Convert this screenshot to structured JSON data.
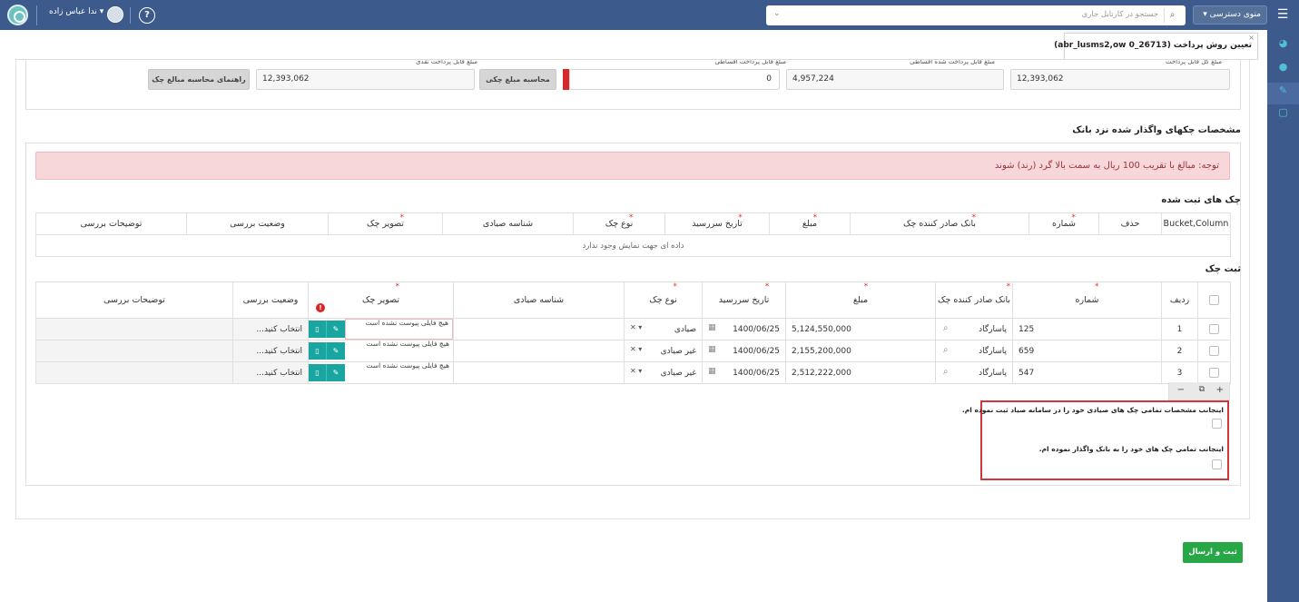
{
  "topbar": {
    "dropdown_label": "منوی دسترسی",
    "search_placeholder": "جستجو در کارتابل جاری",
    "help_label": "?",
    "user_name": "ندا عباس زاده"
  },
  "tab": {
    "title": "تعیین روش پرداخت (abr_lusms2,ow 0_26713)",
    "close": "×"
  },
  "summary": {
    "labels": [
      "مبلغ کل قابل پرداخت",
      "مبلغ قابل پرداخت شده اقساطی",
      "مبلغ قابل پرداخت اقساطی",
      "مبلغ قابل پرداخت نقدی"
    ],
    "values": [
      "12,393,062",
      "4,957,224",
      "0",
      "12,393,062"
    ],
    "calc_button": "محاسبه مبلغ چکی",
    "guide_button": "راهنمای محاسبه مبالغ چک"
  },
  "cheque_section": {
    "title": "مشخصات چکهای واگذار شده نزد بانک",
    "alert": "توجه: مبالغ با تقریب 100 ریال به سمت بالا گرد (رند) شوند"
  },
  "registered": {
    "title": "چک های ثبت شده",
    "headers": [
      "Bucket,Column",
      "حذف",
      "شماره",
      "بانک صادر کننده چک",
      "مبلغ",
      "تاریخ سررسید",
      "نوع چک",
      "شناسه صیادی",
      "تصویر چک",
      "وضعیت بررسی",
      "توضیحات بررسی"
    ],
    "empty_text": "داده ای جهت نمایش وجود ندارد"
  },
  "new_cheques": {
    "title": "ثبت چک",
    "headers": {
      "row": "ردیف",
      "number": "شماره",
      "bank": "بانک صادر کننده چک",
      "amount": "مبلغ",
      "due_date": "تاریخ سررسید",
      "type": "نوع چک",
      "sayad_id": "شناسه صیادی",
      "image": "تصویر چک",
      "status": "وضعیت بررسی",
      "description": "توضیحات بررسی"
    },
    "error_mark": "!",
    "rows": [
      {
        "row": "1",
        "number": "125",
        "bank": "پاسارگاد",
        "amount": "5,124,550,000",
        "due_date": "1400/06/25",
        "type": "صیادی",
        "no_file": "هیچ فایلی پیوست نشده است",
        "status_placeholder": "انتخاب کنید..."
      },
      {
        "row": "2",
        "number": "659",
        "bank": "پاسارگاد",
        "amount": "2,155,200,000",
        "due_date": "1400/06/25",
        "type": "غیر صیادی",
        "no_file": "هیچ فایلی پیوست نشده است",
        "status_placeholder": "انتخاب کنید..."
      },
      {
        "row": "3",
        "number": "547",
        "bank": "پاسارگاد",
        "amount": "2,512,222,000",
        "due_date": "1400/06/25",
        "type": "غیر صیادی",
        "no_file": "هیچ فایلی پیوست نشده است",
        "status_placeholder": "انتخاب کنید..."
      }
    ]
  },
  "confirmations": [
    "اینجانب مشخصات تمامی چک های صیادی خود را در سامانه صیاد ثبت نموده ام.",
    "اینجانب تمامی چک های خود را به بانک واگذار نموده ام."
  ],
  "submit_label": "ثبت و ارسال",
  "colors": {
    "topbar": "#3d5a8c",
    "accent": "#1aa6a0",
    "alert_bg": "#f8d7da",
    "submit": "#27a745",
    "required": "#e03030"
  }
}
